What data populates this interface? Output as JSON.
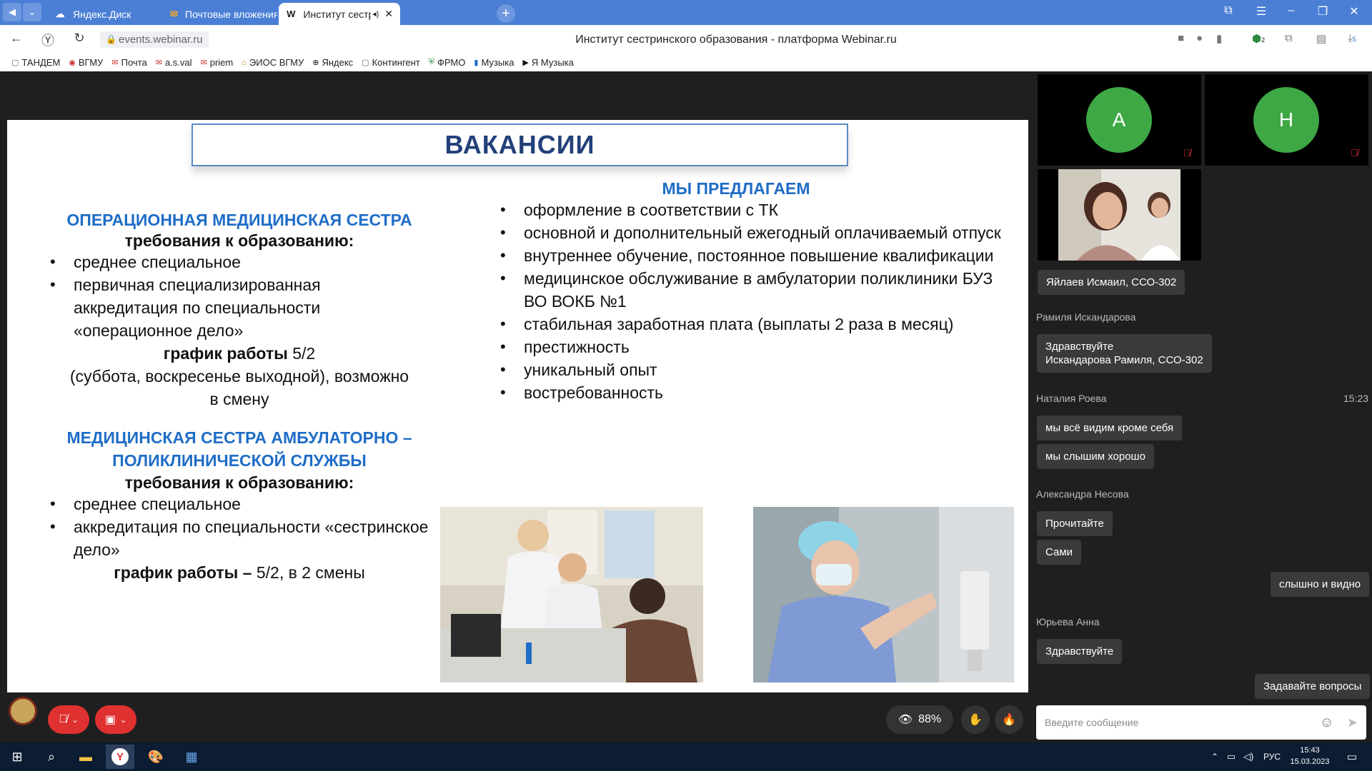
{
  "browser": {
    "tabs": [
      {
        "label": "Яндекс.Диск",
        "favicon": "yandex-disk-icon",
        "active": false
      },
      {
        "label": "Почтовые вложения / Об",
        "favicon": "mail-icon",
        "active": false
      },
      {
        "label": "Институт сестринск",
        "favicon": "webinar-icon",
        "favicon_text": "W",
        "active": true
      }
    ],
    "url": "events.webinar.ru",
    "page_title": "Институт сестринского образования - платформа Webinar.ru",
    "download_badge": "5",
    "extension_badge": "2",
    "bookmarks": [
      "ТАНДЕМ",
      "ВГМУ",
      "Почта",
      "a.s.val",
      "priem",
      "ЭИОС ВГМУ",
      "Яндекс",
      "Контингент",
      "ФРМО",
      "Музыка",
      "Я Музыка"
    ]
  },
  "slide": {
    "title": "ВАКАНСИИ",
    "left": {
      "job1_title": "ОПЕРАЦИОННАЯ МЕДИЦИНСКАЯ СЕСТРА",
      "req_label_1": "требования к образованию:",
      "job1_reqs": [
        "среднее специальное",
        "первичная специализированная аккредитация по специальности «операционное дело»"
      ],
      "schedule1_label": "график работы",
      "schedule1_value": " 5/2",
      "schedule1_note": "(суббота, воскресенье выходной), возможно в смену",
      "job2_title": "МЕДИЦИНСКАЯ СЕСТРА АМБУЛАТОРНО – ПОЛИКЛИНИЧЕСКОЙ СЛУЖБЫ",
      "req_label_2": "требования к образованию:",
      "job2_reqs": [
        "среднее специальное",
        "аккредитация по специальности «сестринское дело»"
      ],
      "schedule2_label": "график работы –",
      "schedule2_value": " 5/2, в 2 смены"
    },
    "right": {
      "offer_title": "МЫ ПРЕДЛАГАЕМ",
      "offers": [
        "оформление в соответствии с ТК",
        "основной и дополнительный ежегодный оплачиваемый отпуск",
        "внутреннее обучение, постоянное повышение квалификации",
        "медицинское обслуживание в амбулатории поликлиники БУЗ ВО ВОКБ №1",
        "стабильная заработная плата (выплаты 2 раза в месяц)",
        "престижность",
        "уникальный опыт",
        "востребованность"
      ]
    }
  },
  "participants": [
    {
      "initial": "А",
      "muted": true
    },
    {
      "initial": "Н",
      "muted": true
    }
  ],
  "chat": {
    "speaker_label": "Яйлаев Исмаил, ССО-302",
    "messages": [
      {
        "author": "Рамиля Искандарова",
        "bubbles": [
          "Здравствуйте\nИскандарова Рамиля, ССО-302"
        ]
      },
      {
        "author": "Наталия Роева",
        "time": "15:23",
        "bubbles": [
          "мы всё видим кроме себя",
          "мы слышим хорошо"
        ]
      },
      {
        "author": "Александра Несова",
        "bubbles": [
          "Прочитайте",
          "Сами"
        ]
      },
      {
        "author": "",
        "own": true,
        "bubbles": [
          "слышно и видно"
        ]
      },
      {
        "author": "Юрьева Анна",
        "bubbles": [
          "Здравствуйте"
        ]
      },
      {
        "author": "",
        "own": true,
        "bubbles": [
          "Задавайте вопросы"
        ]
      }
    ],
    "input_placeholder": "Введите сообщение"
  },
  "controls": {
    "viewers_percent": "88%"
  },
  "taskbar": {
    "lang": "РУС",
    "time": "15:43",
    "date": "15.03.2023"
  },
  "colors": {
    "accent_blue": "#1f6dc7",
    "title_blue": "#23407a",
    "avatar_green": "#3ea844",
    "mute_red": "#e03131"
  }
}
